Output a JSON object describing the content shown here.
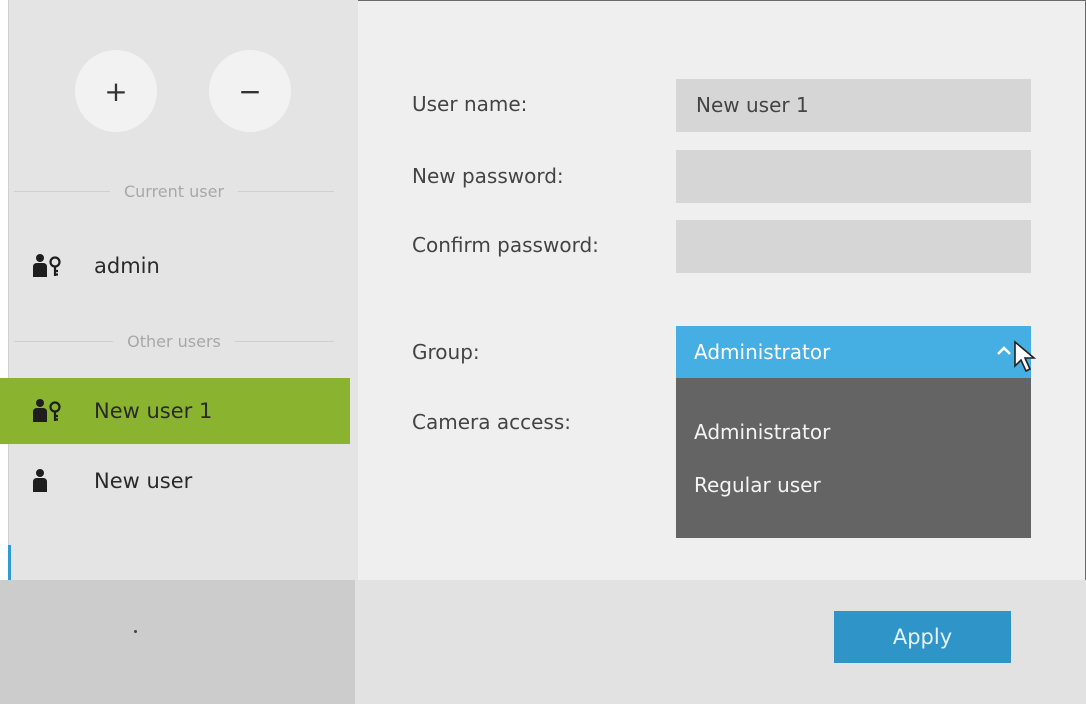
{
  "sidebar": {
    "add_label": "+",
    "remove_label": "−",
    "current_user_heading": "Current user",
    "other_users_heading": "Other users",
    "current_user": {
      "name": "admin",
      "icon": "admin-user-icon"
    },
    "other_users": [
      {
        "name": "New user 1",
        "icon": "admin-user-icon",
        "selected": true
      },
      {
        "name": "New user",
        "icon": "user-icon",
        "selected": false
      }
    ]
  },
  "form": {
    "user_name_label": "User name:",
    "user_name_value": "New user 1",
    "new_password_label": "New password:",
    "confirm_password_label": "Confirm password:",
    "group_label": "Group:",
    "group_value": "Administrator",
    "camera_access_label": "Camera access:",
    "group_options": [
      "Administrator",
      "Regular user"
    ]
  },
  "footer": {
    "apply_label": "Apply"
  },
  "colors": {
    "selected_row": "#8ab42f",
    "select_accent": "#45aee3",
    "apply_button": "#2f95c8",
    "dropdown_bg": "#646464"
  }
}
